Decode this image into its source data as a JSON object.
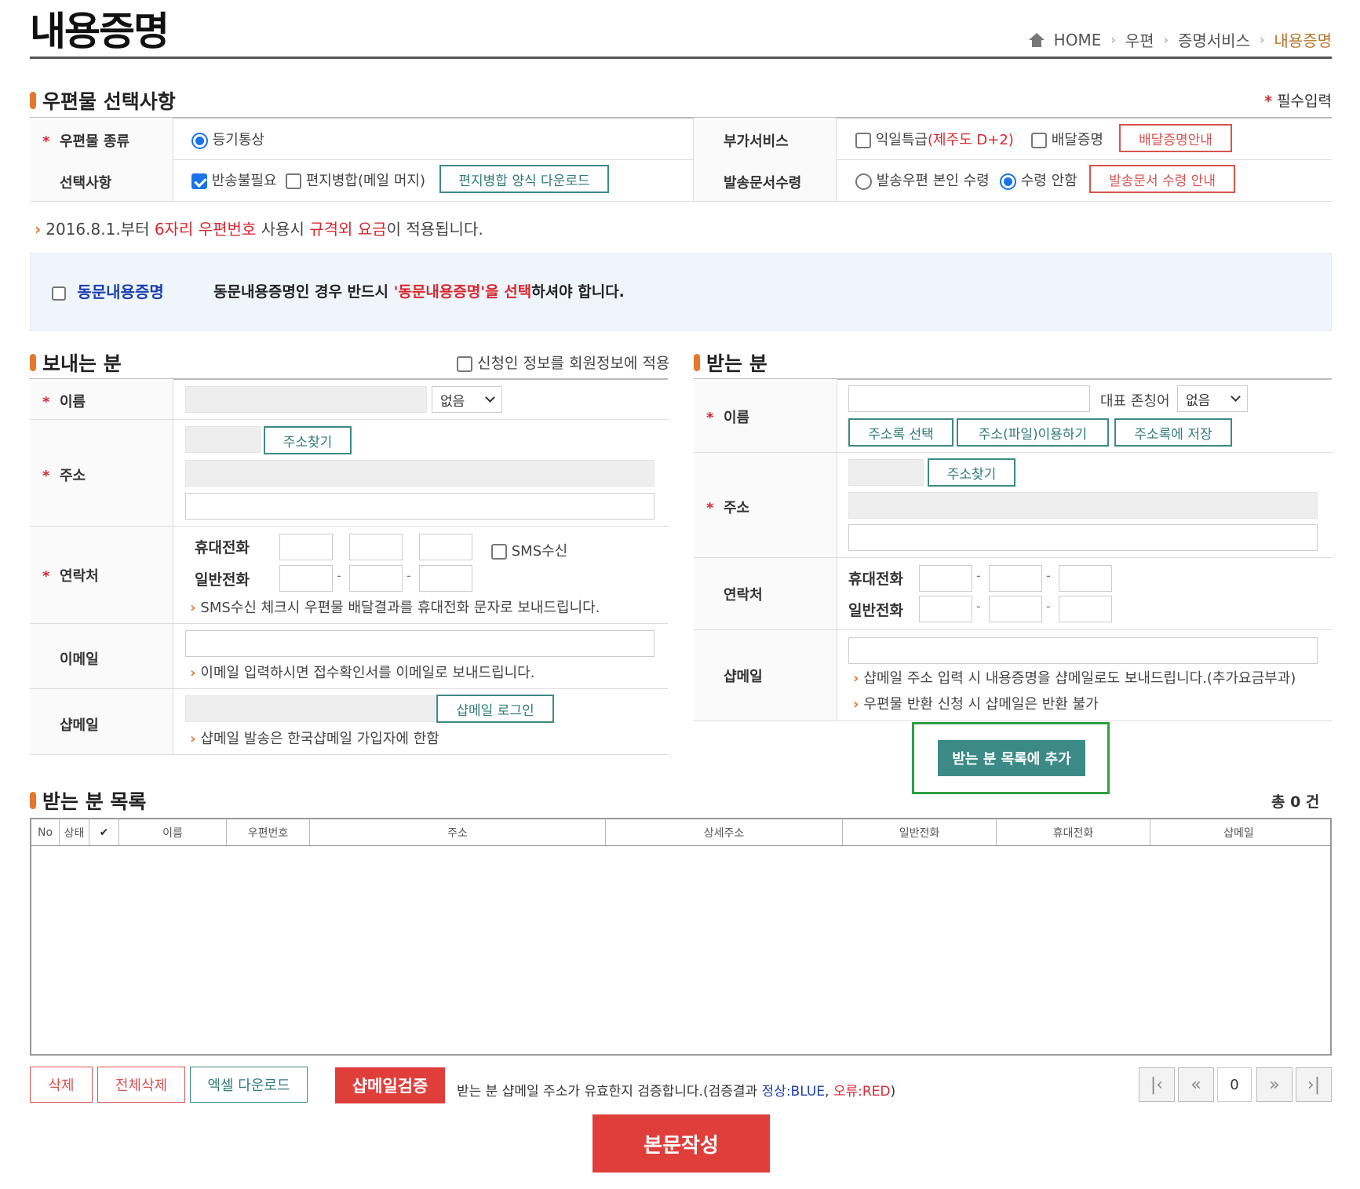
{
  "header": {
    "title": "내용증명",
    "breadcrumb": [
      "HOME",
      "우편",
      "증명서비스",
      "내용증명"
    ]
  },
  "section1": {
    "title": "우편물 선택사항",
    "required_mark": "*",
    "required_note": "필수입력",
    "mail_type_label": "우편물 종류",
    "mail_type_value": "등기통상",
    "extra_service_label": "부가서비스",
    "next_day": "익일특급",
    "next_day_note": "(제주도 D+2)",
    "delivery_proof": "배달증명",
    "delivery_proof_btn": "배달증명안내",
    "options_label": "선택사항",
    "no_return": "반송불필요",
    "mail_merge": "편지병합(메일 머지)",
    "merge_download_btn": "편지병합 양식 다운로드",
    "doc_receive_label": "발송문서수령",
    "receive_self": "발송우편 본인 수령",
    "receive_none": "수령 안함",
    "receive_guide_btn": "발송문서 수령 안내"
  },
  "notice": {
    "p1": "2016.8.1.부터 ",
    "p2": "6자리 우편번호",
    "p3": " 사용시 ",
    "p4": "규격외 요금",
    "p5": "이 적용됩니다."
  },
  "same_content": {
    "label": "동문내용증명",
    "desc1": "동문내용증명인 경우 반드시 ",
    "desc2": "'동문내용증명'을 선택",
    "desc3": "하셔야 합니다."
  },
  "sender": {
    "title": "보내는 분",
    "apply_member": "신청인 정보를 회원정보에 적용",
    "name_label": "이름",
    "title_select": "없음",
    "address_label": "주소",
    "find_address_btn": "주소찾기",
    "contact_label": "연락처",
    "mobile_label": "휴대전화",
    "phone_label": "일반전화",
    "sms_label": "SMS수신",
    "sms_note": "SMS수신 체크시 우편물 배달결과를 휴대전화 문자로 보내드립니다.",
    "email_label": "이메일",
    "email_note": "이메일 입력하시면 접수확인서를 이메일로 보내드립니다.",
    "shamail_label": "샵메일",
    "shamail_login_btn": "샵메일 로그인",
    "shamail_note": "샵메일 발송은 한국샵메일 가입자에 한함"
  },
  "receiver": {
    "title": "받는 분",
    "name_label": "이름",
    "honorific_label": "대표 존칭어",
    "honorific_select": "없음",
    "address_book_btn": "주소록 선택",
    "address_file_btn": "주소(파일)이용하기",
    "save_address_btn": "주소록에 저장",
    "address_label": "주소",
    "find_address_btn": "주소찾기",
    "contact_label": "연락처",
    "mobile_label": "휴대전화",
    "phone_label": "일반전화",
    "shamail_label": "샵메일",
    "shamail_note1": "샵메일 주소 입력 시 내용증명을 샵메일로도 보내드립니다.(추가요금부과)",
    "shamail_note2": "우편물 반환 신청 시 샵메일은 반환 불가",
    "add_btn": "받는 분 목록에 추가"
  },
  "receiver_list": {
    "title": "받는 분 목록",
    "total": "총 0 건",
    "columns": [
      "No",
      "상태",
      "✔",
      "이름",
      "우편번호",
      "주소",
      "상세주소",
      "일반전화",
      "휴대전화",
      "샵메일"
    ]
  },
  "footer": {
    "delete_btn": "삭제",
    "delete_all_btn": "전체삭제",
    "excel_btn": "엑셀 다운로드",
    "verify_btn": "샵메일검증",
    "verify_desc1": "받는 분 샵메일 주소가 유효한지 검증합니다.(검증결과 ",
    "verify_ok": "정상:BLUE",
    "verify_sep": ", ",
    "verify_err": "오류:RED",
    "verify_end": ")",
    "page": "0",
    "write_btn": "본문작성"
  },
  "colors": {
    "accent_orange": "#e8762a",
    "teal": "#3c8a86",
    "red": "#d7282f",
    "blue": "#1a3fb0"
  }
}
